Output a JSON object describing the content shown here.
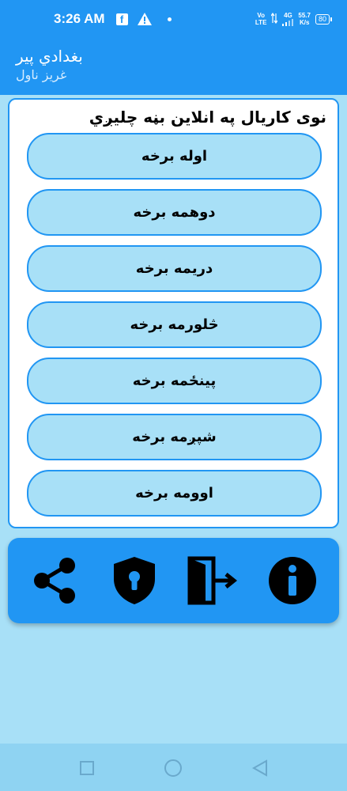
{
  "status_bar": {
    "time": "3:26 AM",
    "volte_top": "Vo",
    "volte_bottom": "LTE",
    "network": "4G",
    "speed_value": "55.7",
    "speed_unit": "K/s",
    "battery": "80"
  },
  "app_bar": {
    "title": "بغدادي پير",
    "subtitle": "غریز ناول"
  },
  "card": {
    "heading": "نوی کاریال په انلاین بڼه چلیږي",
    "parts": [
      {
        "label": "اوله برخه"
      },
      {
        "label": "دوهمه برخه"
      },
      {
        "label": "دریمه برخه"
      },
      {
        "label": "څلورمه برخه"
      },
      {
        "label": "پینځمه برخه"
      },
      {
        "label": "شپږمه برخه"
      },
      {
        "label": "اوومه برخه"
      }
    ]
  },
  "actions": [
    {
      "icon": "share-icon"
    },
    {
      "icon": "shield-lock-icon"
    },
    {
      "icon": "exit-door-icon"
    },
    {
      "icon": "info-icon"
    }
  ],
  "colors": {
    "primary": "#2196f3",
    "background": "#a8e0f7",
    "card": "#ffffff",
    "icon": "#000000"
  }
}
